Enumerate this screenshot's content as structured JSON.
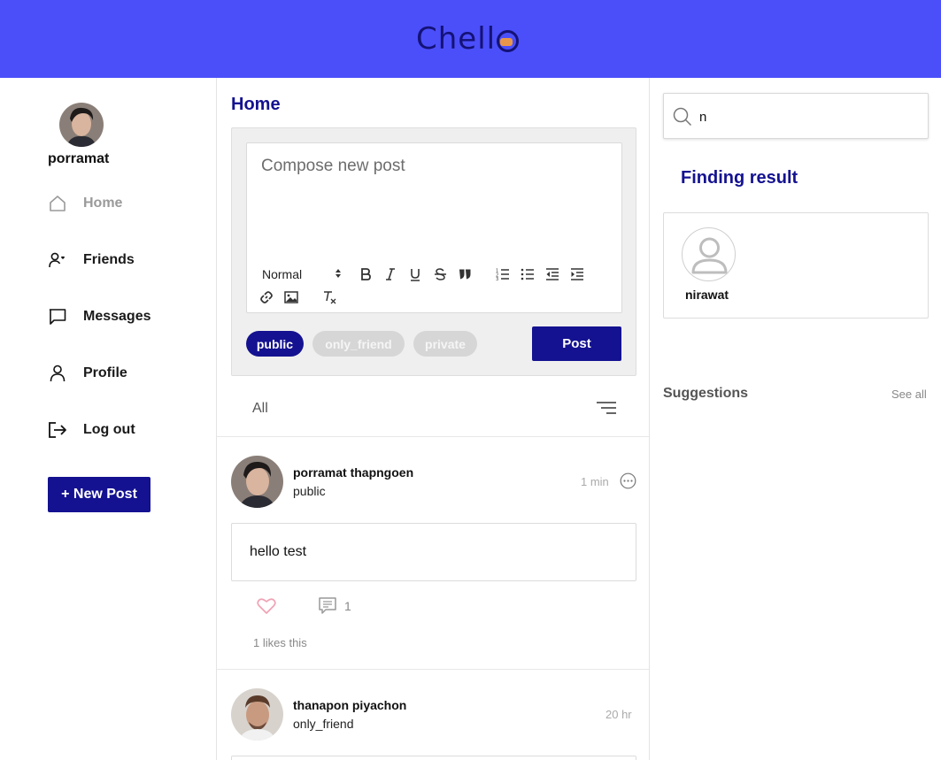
{
  "app": {
    "logo_text": "Chell",
    "brand_color": "#4b4ffa",
    "accent_color": "#141290"
  },
  "sidebar": {
    "user_name": "porramat",
    "items": [
      {
        "label": "Home",
        "icon": "home-icon",
        "active": true
      },
      {
        "label": "Friends",
        "icon": "friends-icon",
        "active": false
      },
      {
        "label": "Messages",
        "icon": "messages-icon",
        "active": false
      },
      {
        "label": "Profile",
        "icon": "profile-icon",
        "active": false
      },
      {
        "label": "Log out",
        "icon": "logout-icon",
        "active": false
      }
    ],
    "new_post_label": "+ New Post"
  },
  "main": {
    "title": "Home",
    "composer": {
      "placeholder": "Compose new post",
      "format_select": "Normal",
      "toolbar_icons": [
        "bold-icon",
        "italic-icon",
        "underline-icon",
        "strike-icon",
        "quote-icon",
        "ordered-list-icon",
        "bullet-list-icon",
        "outdent-icon",
        "indent-icon",
        "link-icon",
        "image-icon",
        "clear-format-icon"
      ],
      "privacy_options": [
        {
          "label": "public",
          "selected": true
        },
        {
          "label": "only_friend",
          "selected": false
        },
        {
          "label": "private",
          "selected": false
        }
      ],
      "post_label": "Post"
    },
    "filter": {
      "label": "All"
    },
    "posts": [
      {
        "author": "porramat thapngoen",
        "privacy": "public",
        "time": "1 min",
        "text": "hello test",
        "comment_count": "1",
        "likes_text": "1 likes this"
      },
      {
        "author": "thanapon piyachon",
        "privacy": "only_friend",
        "time": "20 hr"
      }
    ]
  },
  "right": {
    "search_value": "n",
    "result_title": "Finding result",
    "results": [
      {
        "name": "nirawat"
      }
    ],
    "suggestions_title": "Suggestions",
    "see_all_label": "See all"
  }
}
